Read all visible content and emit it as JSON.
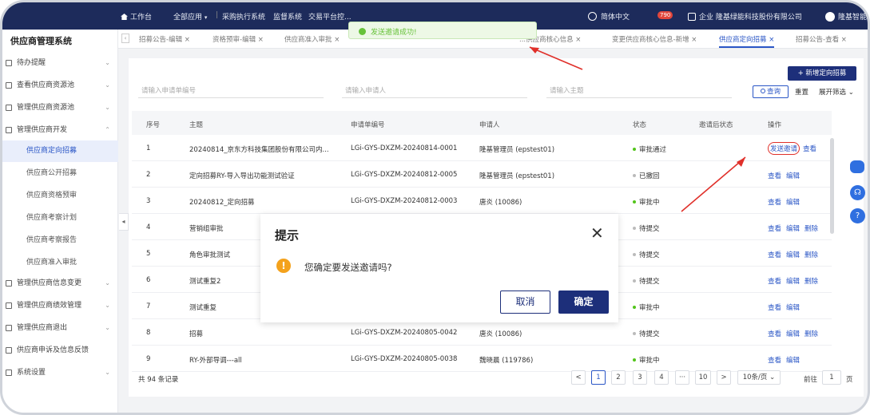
{
  "topbar": {
    "workspace": "工作台",
    "all_apps": "全部应用",
    "menu_items": [
      "采购执行系统",
      "监督系统",
      "交易平台控..."
    ],
    "supplier_mgmt": "供应商管理",
    "language": "简体中文",
    "notification_count": "790",
    "org_prefix": "企业",
    "company": "隆基绿能科技股份有限公司",
    "user": "隆基智能"
  },
  "toast": {
    "text": "发送邀请成功!"
  },
  "sidebar": {
    "title": "供应商管理系统",
    "items": [
      {
        "label": "待办提醒"
      },
      {
        "label": "查看供应商资源池"
      },
      {
        "label": "管理供应商资源池"
      },
      {
        "label": "管理供应商开发"
      }
    ],
    "subitems": [
      {
        "label": "供应商定向招募",
        "active": true
      },
      {
        "label": "供应商公开招募"
      },
      {
        "label": "供应商资格预审"
      },
      {
        "label": "供应商考察计划"
      },
      {
        "label": "供应商考察报告"
      },
      {
        "label": "供应商准入审批"
      }
    ],
    "bottom_items": [
      {
        "label": "管理供应商信息变更"
      },
      {
        "label": "管理供应商绩效管理"
      },
      {
        "label": "管理供应商退出"
      },
      {
        "label": "供应商申诉及信息反馈"
      },
      {
        "label": "系统设置"
      }
    ]
  },
  "tabs": [
    {
      "label": "招募公告-编辑"
    },
    {
      "label": "资格预审-编辑"
    },
    {
      "label": "供应商准入审批"
    },
    {
      "label": "...供应商核心信息"
    },
    {
      "label": "变更供应商核心信息-新增"
    },
    {
      "label": "供应商定向招募",
      "active": true
    },
    {
      "label": "招募公告-查看"
    }
  ],
  "toolbar": {
    "add_label": "+ 新增定向招募",
    "filter_placeholders": [
      "请输入申请单编号",
      "请输入申请人",
      "请输入主题"
    ],
    "query_label": "查询",
    "reset_label": "重置",
    "expand_label": "展开筛选"
  },
  "table": {
    "columns": [
      "序号",
      "主题",
      "申请单编号",
      "申请人",
      "状态",
      "邀请后状态",
      "操作"
    ],
    "rows": [
      {
        "no": "1",
        "subject": "20240814_京东方科技集团股份有限公司内...",
        "code": "LGi-GYS-DXZM-20240814-0001",
        "applicant": "隆基管理员 (epstest01)",
        "status": "审批通过",
        "status_color": "#52c41a",
        "after": "",
        "ops": [
          "发送邀请",
          "查看"
        ]
      },
      {
        "no": "2",
        "subject": "定向招募RY-导入导出功能测试验证",
        "code": "LGi-GYS-DXZM-20240812-0005",
        "applicant": "隆基管理员 (epstest01)",
        "status": "已撤回",
        "status_color": "#bbbbbb",
        "after": "",
        "ops": [
          "查看",
          "编辑"
        ]
      },
      {
        "no": "3",
        "subject": "20240812_定向招募",
        "code": "LGi-GYS-DXZM-20240812-0003",
        "applicant": "唐炎 (10086)",
        "status": "审批中",
        "status_color": "#52c41a",
        "after": "",
        "ops": [
          "查看",
          "编辑"
        ]
      },
      {
        "no": "4",
        "subject": "营销组审批",
        "code": "",
        "applicant": "",
        "status": "待提交",
        "status_color": "#bbbbbb",
        "after": "",
        "ops": [
          "查看",
          "编辑",
          "删除"
        ]
      },
      {
        "no": "5",
        "subject": "角色审批测试",
        "code": "",
        "applicant": "",
        "status": "待提交",
        "status_color": "#bbbbbb",
        "after": "",
        "ops": [
          "查看",
          "编辑",
          "删除"
        ]
      },
      {
        "no": "6",
        "subject": "测试重复2",
        "code": "",
        "applicant": "",
        "status": "待提交",
        "status_color": "#bbbbbb",
        "after": "",
        "ops": [
          "查看",
          "编辑",
          "删除"
        ]
      },
      {
        "no": "7",
        "subject": "测试重复",
        "code": "",
        "applicant": "",
        "status": "审批中",
        "status_color": "#52c41a",
        "after": "",
        "ops": [
          "查看",
          "编辑"
        ]
      },
      {
        "no": "8",
        "subject": "招募",
        "code": "LGi-GYS-DXZM-20240805-0042",
        "applicant": "唐炎 (10086)",
        "status": "待提交",
        "status_color": "#bbbbbb",
        "after": "",
        "ops": [
          "查看",
          "编辑",
          "删除"
        ]
      },
      {
        "no": "9",
        "subject": "RY-外部导调---all",
        "code": "LGi-GYS-DXZM-20240805-0038",
        "applicant": "魏晓晨 (119786)",
        "status": "审批中",
        "status_color": "#52c41a",
        "after": "",
        "ops": [
          "查看",
          "编辑"
        ]
      }
    ]
  },
  "footer": {
    "total": "共 94 条记录",
    "pages": [
      "1",
      "2",
      "3",
      "4",
      "···",
      "10"
    ],
    "prev": "<",
    "next": ">",
    "page_size": "10条/页",
    "goto_label": "前往",
    "goto_value": "1",
    "page_suffix": "页"
  },
  "modal": {
    "title": "提示",
    "message": "您确定要发送邀请吗?",
    "cancel": "取消",
    "confirm": "确定"
  },
  "colors": {
    "primary": "#1d2f7a",
    "link": "#2a56c6",
    "success": "#67c23a",
    "annotation": "#e0302a"
  }
}
